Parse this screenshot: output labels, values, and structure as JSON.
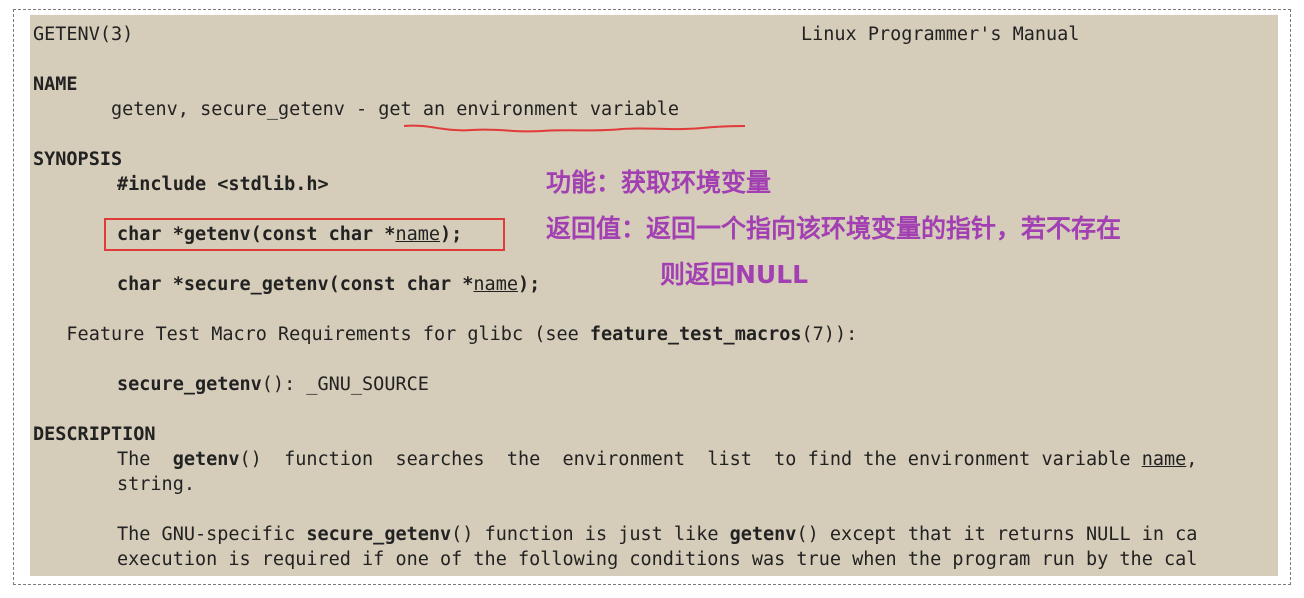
{
  "header": {
    "left": "GETENV(3)",
    "right": "Linux Programmer's Manual"
  },
  "name_section": {
    "heading": "NAME",
    "indent": "       ",
    "text_1": "getenv, secure_getenv - ",
    "text_2": "get an environment variable"
  },
  "synopsis": {
    "heading": "SYNOPSIS",
    "include": "#include <stdlib.h>",
    "getenv_pre": "char *getenv(const char *",
    "getenv_param": "name",
    "getenv_post": ");",
    "secure_pre": "char *secure_getenv(const char *",
    "secure_param": "name",
    "secure_post": ");",
    "ftm_indent": "   ",
    "ftm_pre": "Feature Test Macro Requirements for glibc (see ",
    "ftm_bold": "feature_test_macros",
    "ftm_post": "(7)):",
    "req_bold": "secure_getenv",
    "req_post": "(): _GNU_SOURCE"
  },
  "description": {
    "heading": "DESCRIPTION",
    "p1_l1_a": "The  ",
    "p1_l1_b": "getenv",
    "p1_l1_c": "()  function  searches  the  environment  list  to find the environment variable ",
    "p1_l1_d": "name",
    "p1_l1_e": ",",
    "p1_l2": "string.",
    "p2_l1_a": "The GNU-specific ",
    "p2_l1_b": "secure_getenv",
    "p2_l1_c": "() function is just like ",
    "p2_l1_d": "getenv",
    "p2_l1_e": "() except that it returns NULL in ca",
    "p2_l2": "execution is required if one of the following conditions was true when the program run by the cal"
  },
  "annotations": {
    "function": "功能：获取环境变量",
    "return_1": "返回值：返回一个指向该环境变量的指针，若不存在",
    "return_2": "则返回NULL",
    "color": "#a23fb2",
    "box_color": "#e03a3a"
  },
  "colors": {
    "background": "#d5ccb9",
    "text": "#222222"
  }
}
